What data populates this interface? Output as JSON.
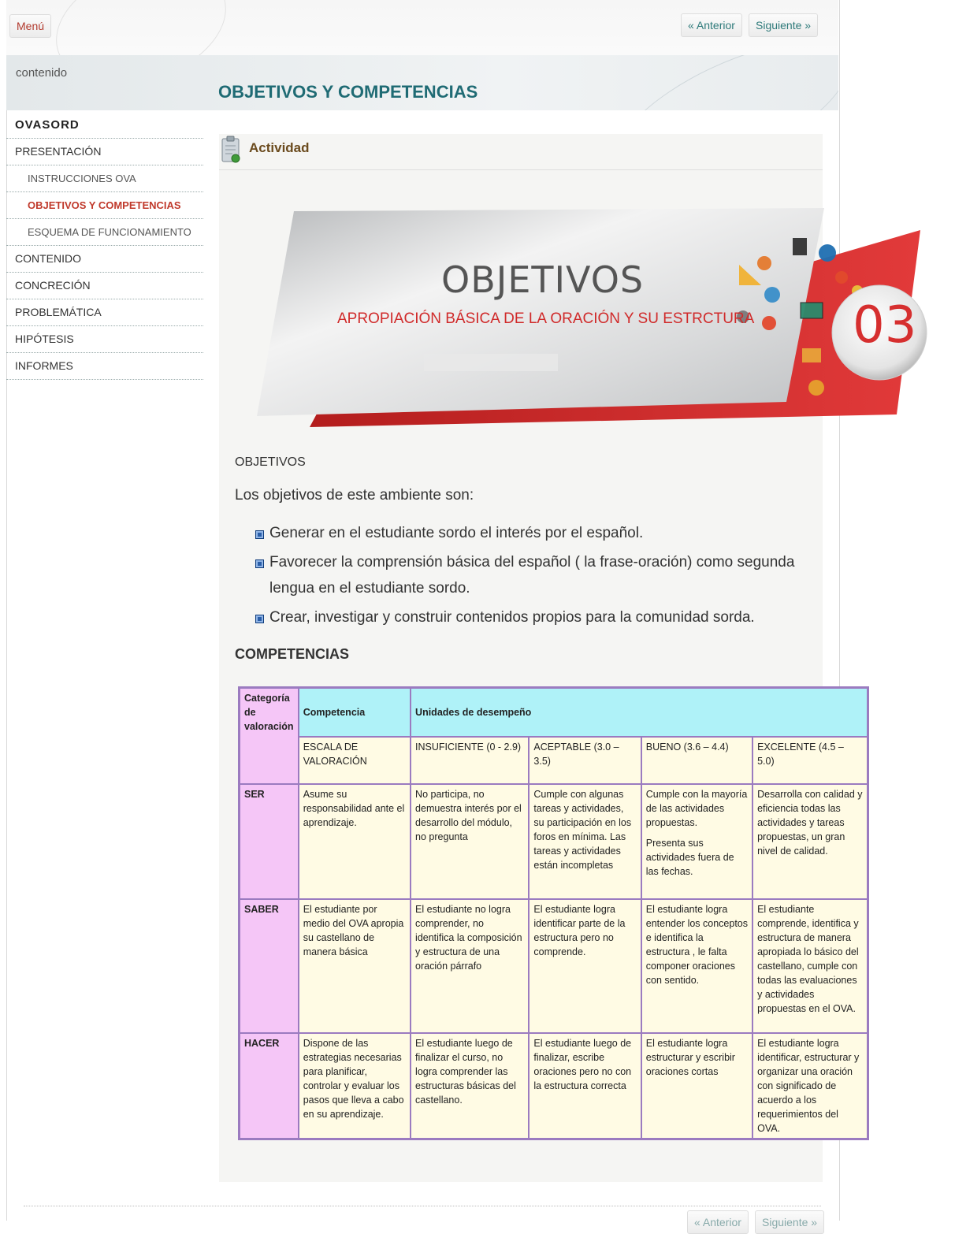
{
  "nav": {
    "menu": "Menú",
    "prev": "« Anterior",
    "next": "Siguiente »"
  },
  "header": {
    "section_label": "contenido",
    "page_title": "OBJETIVOS Y COMPETENCIAS"
  },
  "sidebar": {
    "items": [
      {
        "label": "OVASORD"
      },
      {
        "label": "PRESENTACIÓN"
      },
      {
        "label": "INSTRUCCIONES OVA"
      },
      {
        "label": "OBJETIVOS Y COMPETENCIAS"
      },
      {
        "label": "ESQUEMA DE FUNCIONAMIENTO"
      },
      {
        "label": "CONTENIDO"
      },
      {
        "label": "CONCRECIÓN"
      },
      {
        "label": "PROBLEMÁTICA"
      },
      {
        "label": "HIPÓTESIS"
      },
      {
        "label": "INFORMES"
      }
    ]
  },
  "activity": {
    "label": "Actividad"
  },
  "banner": {
    "title": "OBJETIVOS",
    "subtitle": "APROPIACIÓN BÁSICA DE  LA ORACIÓN Y SU ESTRCTURA",
    "number": "03",
    "accent": "#d62f2f"
  },
  "objectives": {
    "heading": "OBJETIVOS",
    "intro": "Los objetivos de este ambiente son:",
    "items": [
      "Generar en el estudiante sordo el interés por el español.",
      "Favorecer la comprensión básica del español ( la frase-oración) como segunda lengua en el estudiante sordo.",
      "Crear, investigar y construir contenidos propios para la comunidad sorda."
    ]
  },
  "competencies": {
    "heading": "COMPETENCIAS",
    "table": {
      "cat_header": "Categoría de valoración",
      "comp_header": "Competencia",
      "units_header": "Unidades de desempeño",
      "scale_label": "ESCALA DE VALORACIÓN",
      "levels": [
        "INSUFICIENTE (0 - 2.9)",
        "ACEPTABLE (3.0 – 3.5)",
        "BUENO (3.6 – 4.4)",
        "EXCELENTE (4.5 – 5.0)"
      ],
      "rows": [
        {
          "category": "SER",
          "competence": "Asume su responsabilidad ante el aprendizaje.",
          "cells": [
            "No participa, no demuestra interés por el desarrollo del módulo, no pregunta",
            "Cumple con algunas tareas y actividades, su participación en los foros en mínima. Las tareas y actividades están incompletas",
            "Cumple con la mayoría de las actividades propuestas.",
            "Desarrolla con calidad y eficiencia todas las actividades y tareas propuestas, un gran nivel de calidad."
          ],
          "extra": "Presenta sus actividades fuera de las fechas."
        },
        {
          "category": "SABER",
          "competence": "El estudiante por medio del OVA apropia su castellano de manera básica",
          "cells": [
            "El estudiante no logra comprender, no identifica la composición y estructura de una oración párrafo",
            "El estudiante logra identificar parte de la estructura pero no comprende.",
            "El estudiante logra entender los conceptos e identifica la estructura , le falta componer oraciones con sentido.",
            "El estudiante comprende, identifica y estructura de manera apropiada lo básico del castellano, cumple  con todas las evaluaciones y actividades propuestas en el OVA."
          ]
        },
        {
          "category": "HACER",
          "competence": "Dispone de las estrategias necesarias para planificar, controlar y evaluar los pasos que lleva a cabo en su aprendizaje.",
          "cells": [
            "El estudiante luego de finalizar  el curso, no logra comprender las estructuras básicas del castellano.",
            "El estudiante luego de finalizar, escribe oraciones pero no con la estructura correcta",
            "El estudiante logra estructurar y escribir oraciones cortas",
            "El estudiante logra identificar, estructurar y organizar una oración con significado de acuerdo a los requerimientos del OVA."
          ]
        }
      ]
    }
  }
}
